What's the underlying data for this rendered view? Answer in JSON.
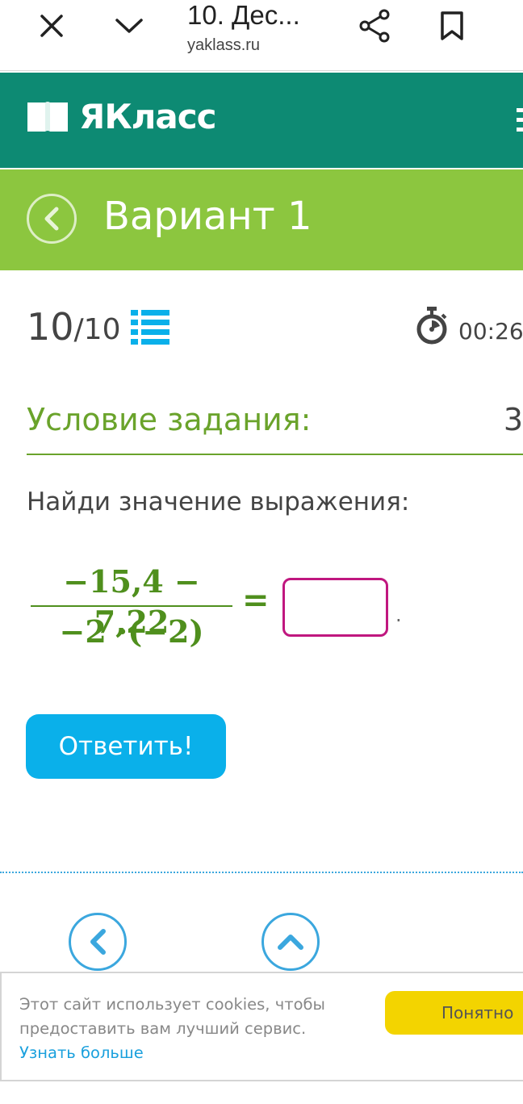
{
  "browser": {
    "title": "10. Дес...",
    "url": "yaklass.ru"
  },
  "site": {
    "logo_text": "ЯКласс"
  },
  "variant": {
    "title": "Вариант 1"
  },
  "progress": {
    "current": "10",
    "total": "/10"
  },
  "timer": {
    "value": "00:26"
  },
  "condition": {
    "title": "Условие задания:",
    "points": "3"
  },
  "task": {
    "prompt": "Найди значение выражения:",
    "numerator": "−15,4 − 7,22",
    "denominator": "−2 ·(−2)",
    "equals": "=",
    "answer_value": "",
    "period": "."
  },
  "submit": {
    "label": "Ответить!"
  },
  "cookie": {
    "text": "Этот сайт использует cookies, чтобы предоставить вам лучший сервис. ",
    "link": "Узнать больше",
    "button": "Понятно"
  },
  "colors": {
    "header": "#0d8a73",
    "variant_bar": "#8cc63f",
    "accent_blue": "#0ab0ea",
    "math_green": "#4f8f1d",
    "input_border": "#c0177f",
    "cookie_button": "#f3d400"
  }
}
